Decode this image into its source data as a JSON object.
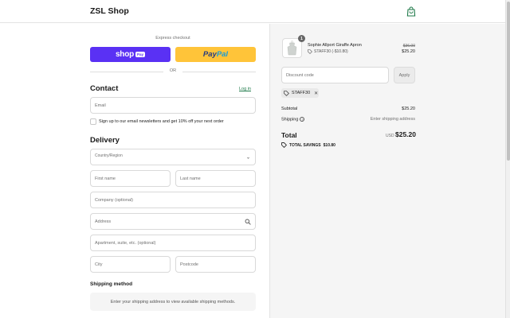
{
  "header": {
    "shop_name": "ZSL Shop",
    "cart_icon": "shopping-bag-icon"
  },
  "express": {
    "label": "Express checkout",
    "shoppay_text": "shop",
    "shoppay_badge": "Pay",
    "paypal_1": "Pay",
    "paypal_2": "Pal",
    "or_text": "OR",
    "shoppay_color": "#5a31f4",
    "paypal_color": "#ffc439"
  },
  "contact": {
    "title": "Contact",
    "login_link": "Log in",
    "email_placeholder": "Email",
    "newsletter_label": "Sign up to our email newsletters and get 10% off your next order"
  },
  "delivery": {
    "title": "Delivery",
    "country_label": "Country/Region",
    "first_name": "First name",
    "last_name": "Last name",
    "company": "Company (optional)",
    "address": "Address",
    "apartment": "Apartment, suite, etc. (optional)",
    "city": "City",
    "postcode": "Postcode"
  },
  "shipping": {
    "title": "Shipping method",
    "message": "Enter your shipping address to view available shipping methods."
  },
  "order": {
    "item": {
      "quantity": "1",
      "name": "Sophie Allport Giraffe Apron",
      "discount": "STAFF30 (-$10.80)",
      "original_price": "$36.00",
      "price": "$25.20"
    },
    "discount_placeholder": "Discount code",
    "apply_label": "Apply",
    "applied_code": "STAFF30",
    "subtotal_label": "Subtotal",
    "subtotal_value": "$25.20",
    "shipping_label": "Shipping",
    "shipping_value": "Enter shipping address",
    "total_label": "Total",
    "total_currency": "USD",
    "total_value": "$25.20",
    "savings_label": "TOTAL SAVINGS",
    "savings_value": "$10.80"
  }
}
